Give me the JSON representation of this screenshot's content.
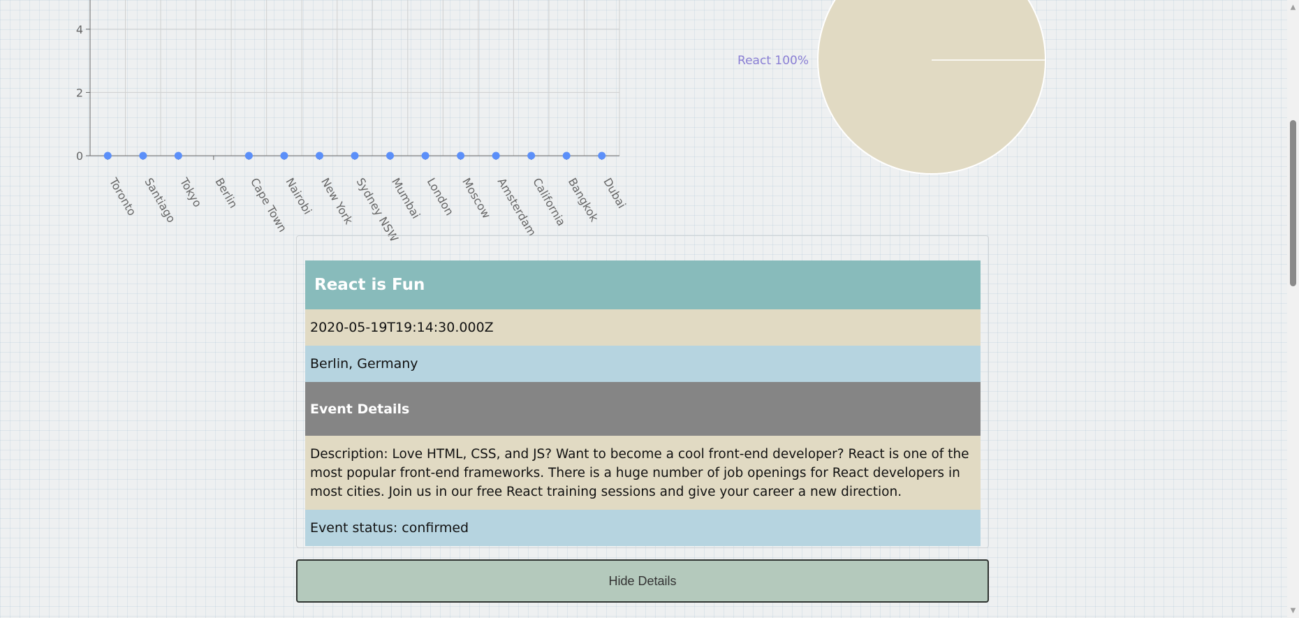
{
  "scatter": {
    "chart_data": {
      "type": "scatter",
      "categories": [
        "Toronto",
        "Santiago",
        "Tokyo",
        "Berlin",
        "Cape Town",
        "Nairobi",
        "New York",
        "Sydney NSW",
        "Mumbai",
        "London",
        "Moscow",
        "Amsterdam",
        "California",
        "Bangkok",
        "Dubai"
      ],
      "points": [
        {
          "x": "Toronto",
          "y": 0
        },
        {
          "x": "Santiago",
          "y": 0
        },
        {
          "x": "Tokyo",
          "y": 0
        },
        {
          "x": "Cape Town",
          "y": 0
        },
        {
          "x": "Nairobi",
          "y": 0
        },
        {
          "x": "New York",
          "y": 0
        },
        {
          "x": "Sydney NSW",
          "y": 0
        },
        {
          "x": "Mumbai",
          "y": 0
        },
        {
          "x": "London",
          "y": 0
        },
        {
          "x": "Moscow",
          "y": 0
        },
        {
          "x": "Amsterdam",
          "y": 0
        },
        {
          "x": "California",
          "y": 0
        },
        {
          "x": "Bangkok",
          "y": 0
        },
        {
          "x": "Dubai",
          "y": 0
        }
      ],
      "y_ticks": [
        "0",
        "2",
        "4"
      ],
      "ylim": [
        0,
        4
      ],
      "grid": true,
      "point_color": "#5b8ff9"
    }
  },
  "pie": {
    "chart_data": {
      "type": "pie",
      "slices": [
        {
          "label": "React",
          "value": 100,
          "display": "React 100%"
        }
      ],
      "slice_color": "#e1dac3",
      "label_color": "#8a7fd4"
    }
  },
  "event": {
    "title": "React is Fun",
    "date": "2020-05-19T19:14:30.000Z",
    "location": "Berlin, Germany",
    "details_heading": "Event Details",
    "description": "Description: Love HTML, CSS, and JS? Want to become a cool front-end developer? React is one of the most popular front-end frameworks. There is a huge number of job openings for React developers in most cities. Join us in our free React training sessions and give your career a new direction.",
    "status": "Event status: confirmed"
  },
  "hide_button": {
    "label": "Hide Details"
  }
}
